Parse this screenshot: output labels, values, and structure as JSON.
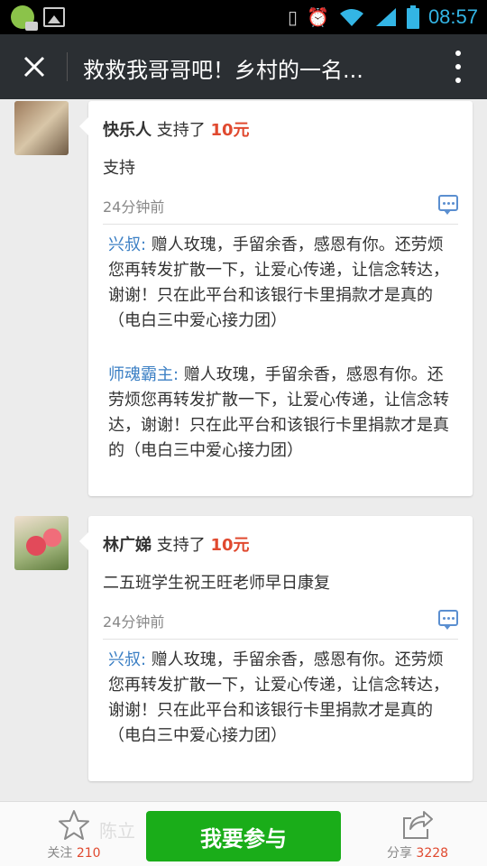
{
  "status_bar": {
    "time": "08:57"
  },
  "header": {
    "title": "救救我哥哥吧！乡村的一名..."
  },
  "entries": [
    {
      "name": "快乐人",
      "action": " 支持了 ",
      "amount": "10元",
      "message": "支持",
      "time": "24分钟前",
      "replies": [
        {
          "author": "兴叔:",
          "text": " 赠人玫瑰，手留余香，感恩有你。还劳烦您再转发扩散一下，让爱心传递，让信念转达，谢谢！只在此平台和该银行卡里捐款才是真的（电白三中爱心接力团）"
        },
        {
          "author": "师魂霸主:",
          "text": " 赠人玫瑰，手留余香，感恩有你。还劳烦您再转发扩散一下，让爱心传递，让信念转达，谢谢！只在此平台和该银行卡里捐款才是真的（电白三中爱心接力团）"
        }
      ]
    },
    {
      "name": "林广娣",
      "action": " 支持了 ",
      "amount": "10元",
      "message": "二五班学生祝王旺老师早日康复",
      "time": "24分钟前",
      "replies": [
        {
          "author": "兴叔:",
          "text": " 赠人玫瑰，手留余香，感恩有你。还劳烦您再转发扩散一下，让爱心传递，让信念转达，谢谢！只在此平台和该银行卡里捐款才是真的（电白三中爱心接力团）"
        }
      ]
    }
  ],
  "bottom_bar": {
    "ghost_name": "陈立",
    "follow_label": "关注",
    "follow_count": "210",
    "join_label": "我要参与",
    "share_label": "分享",
    "share_count": "3228"
  },
  "colors": {
    "header_bg": "#2b2f33",
    "amount": "#e0492f",
    "reply_author": "#3b7fc4",
    "join_button": "#1aad19",
    "time_accent": "#33b5e5"
  },
  "icons": [
    "close-icon",
    "more-vertical-icon",
    "comment-icon",
    "star-icon",
    "share-icon",
    "wifi-icon",
    "signal-icon",
    "battery-icon",
    "alarm-icon",
    "vibrate-icon"
  ]
}
